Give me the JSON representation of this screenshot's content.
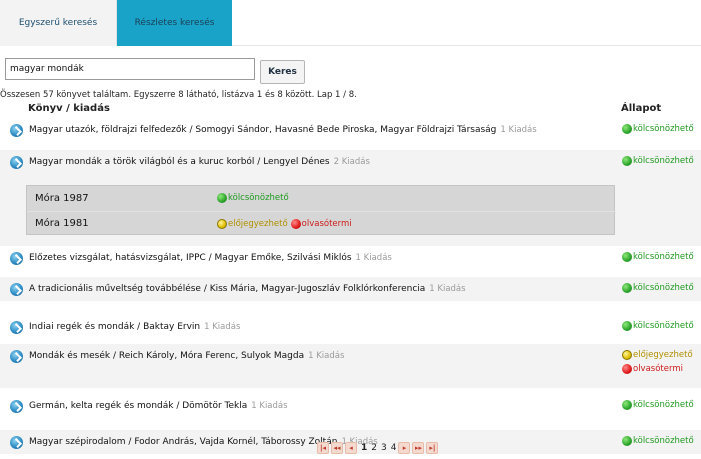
{
  "tabs": {
    "simple": "Egyszerű keresés",
    "advanced": "Részletes keresés"
  },
  "search": {
    "value": "magyar mondák",
    "button": "Keres"
  },
  "summary": "Összesen 57 könyvet találtam. Egyszerre 8 látható, listázva 1 és 8 között. Lap 1 / 8.",
  "headers": {
    "book": "Könyv / kiadás",
    "status": "Állapot"
  },
  "results": [
    {
      "title": "Magyar utazók, földrajzi felfedezők / Somogyi Sándor, Havasné Bede Piroska, Magyar Földrajzi Társaság",
      "edition": "1 Kiadás",
      "statuses": [
        {
          "color": "green",
          "label": "kölcsönözhető"
        }
      ]
    },
    {
      "title": "Magyar mondák a török világból és a kuruc korból / Lengyel Dénes",
      "edition": "2 Kiadás",
      "statuses": [
        {
          "color": "green",
          "label": "kölcsönözhető"
        }
      ],
      "sub_editions": [
        {
          "label": "Móra 1987",
          "statuses": [
            {
              "color": "green",
              "label": "kölcsönözhető"
            }
          ]
        },
        {
          "label": "Móra 1981",
          "statuses": [
            {
              "color": "yellow",
              "label": "előjegyezhető"
            },
            {
              "color": "red",
              "label": "olvasótermi"
            }
          ]
        }
      ]
    },
    {
      "title": "Előzetes vizsgálat, hatásvizsgálat, IPPC / Magyar Emőke, Szilvási Miklós",
      "edition": "1 Kiadás",
      "statuses": [
        {
          "color": "green",
          "label": "kölcsönözhető"
        }
      ]
    },
    {
      "title": "A tradicionális műveltség továbbélése / Kiss Mária, Magyar-Jugoszláv Folklórkonferencia",
      "edition": "1 Kiadás",
      "statuses": [
        {
          "color": "green",
          "label": "kölcsönözhető"
        }
      ]
    },
    {
      "title": "Indiai regék és mondák / Baktay Ervin",
      "edition": "1 Kiadás",
      "statuses": [
        {
          "color": "green",
          "label": "kölcsönözhető"
        }
      ]
    },
    {
      "title": "Mondák és mesék / Reich Károly, Móra Ferenc, Sulyok Magda",
      "edition": "1 Kiadás",
      "statuses": [
        {
          "color": "yellow",
          "label": "előjegyezhető"
        },
        {
          "color": "red",
          "label": "olvasótermi"
        }
      ]
    },
    {
      "title": "Germán, kelta regék és mondák / Dömötör Tekla",
      "edition": "1 Kiadás",
      "statuses": [
        {
          "color": "green",
          "label": "kölcsönözhető"
        }
      ]
    },
    {
      "title": "Magyar szépirodalom / Fodor András, Vajda Kornél, Táborossy Zoltán",
      "edition": "1 Kiadás",
      "statuses": [
        {
          "color": "green",
          "label": "kölcsönözhető"
        }
      ]
    }
  ],
  "pagination": {
    "pages": [
      "1",
      "2",
      "3",
      "4"
    ],
    "current": "1"
  }
}
